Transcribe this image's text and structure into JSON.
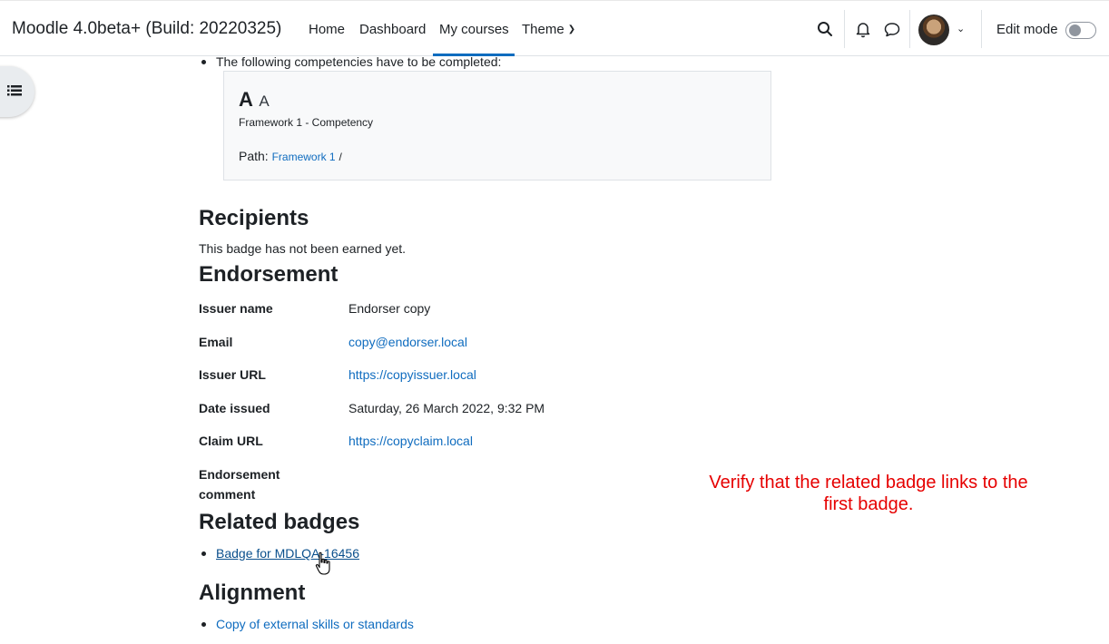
{
  "navbar": {
    "site_name": "Moodle 4.0beta+ (Build: 20220325)",
    "links": [
      "Home",
      "Dashboard",
      "My courses",
      "Theme"
    ],
    "active_link": "My courses",
    "edit_mode_label": "Edit mode",
    "edit_mode_on": false
  },
  "competencies": {
    "intro": "The following competencies have to be completed:",
    "card": {
      "shortname": "A",
      "idnumber": "A",
      "subtitle": "Framework 1 - Competency",
      "path_label": "Path:",
      "path_link": "Framework 1",
      "path_sep": "/"
    }
  },
  "recipients": {
    "heading": "Recipients",
    "text": "This badge has not been earned yet."
  },
  "endorsement": {
    "heading": "Endorsement",
    "rows": [
      {
        "label": "Issuer name",
        "value": "Endorser copy"
      },
      {
        "label": "Email",
        "value": "copy@endorser.local"
      },
      {
        "label": "Issuer URL",
        "value": "https://copyissuer.local"
      },
      {
        "label": "Date issued",
        "value": "Saturday, 26 March 2022, 9:32 PM"
      },
      {
        "label": "Claim URL",
        "value": "https://copyclaim.local"
      },
      {
        "label": "Endorsement comment",
        "value": ""
      }
    ],
    "comment_label_line1": "Endorsement",
    "comment_label_line2": "comment"
  },
  "related": {
    "heading": "Related badges",
    "items": [
      "Badge for MDLQA-16456"
    ]
  },
  "alignment": {
    "heading": "Alignment",
    "items": [
      "Copy of external skills or standards"
    ]
  },
  "annotation": {
    "line1": "Verify that the related badge links to the",
    "line2": "first badge."
  },
  "colors": {
    "link": "#0f6cbf",
    "annotation": "#e60000",
    "text": "#1d2125"
  }
}
